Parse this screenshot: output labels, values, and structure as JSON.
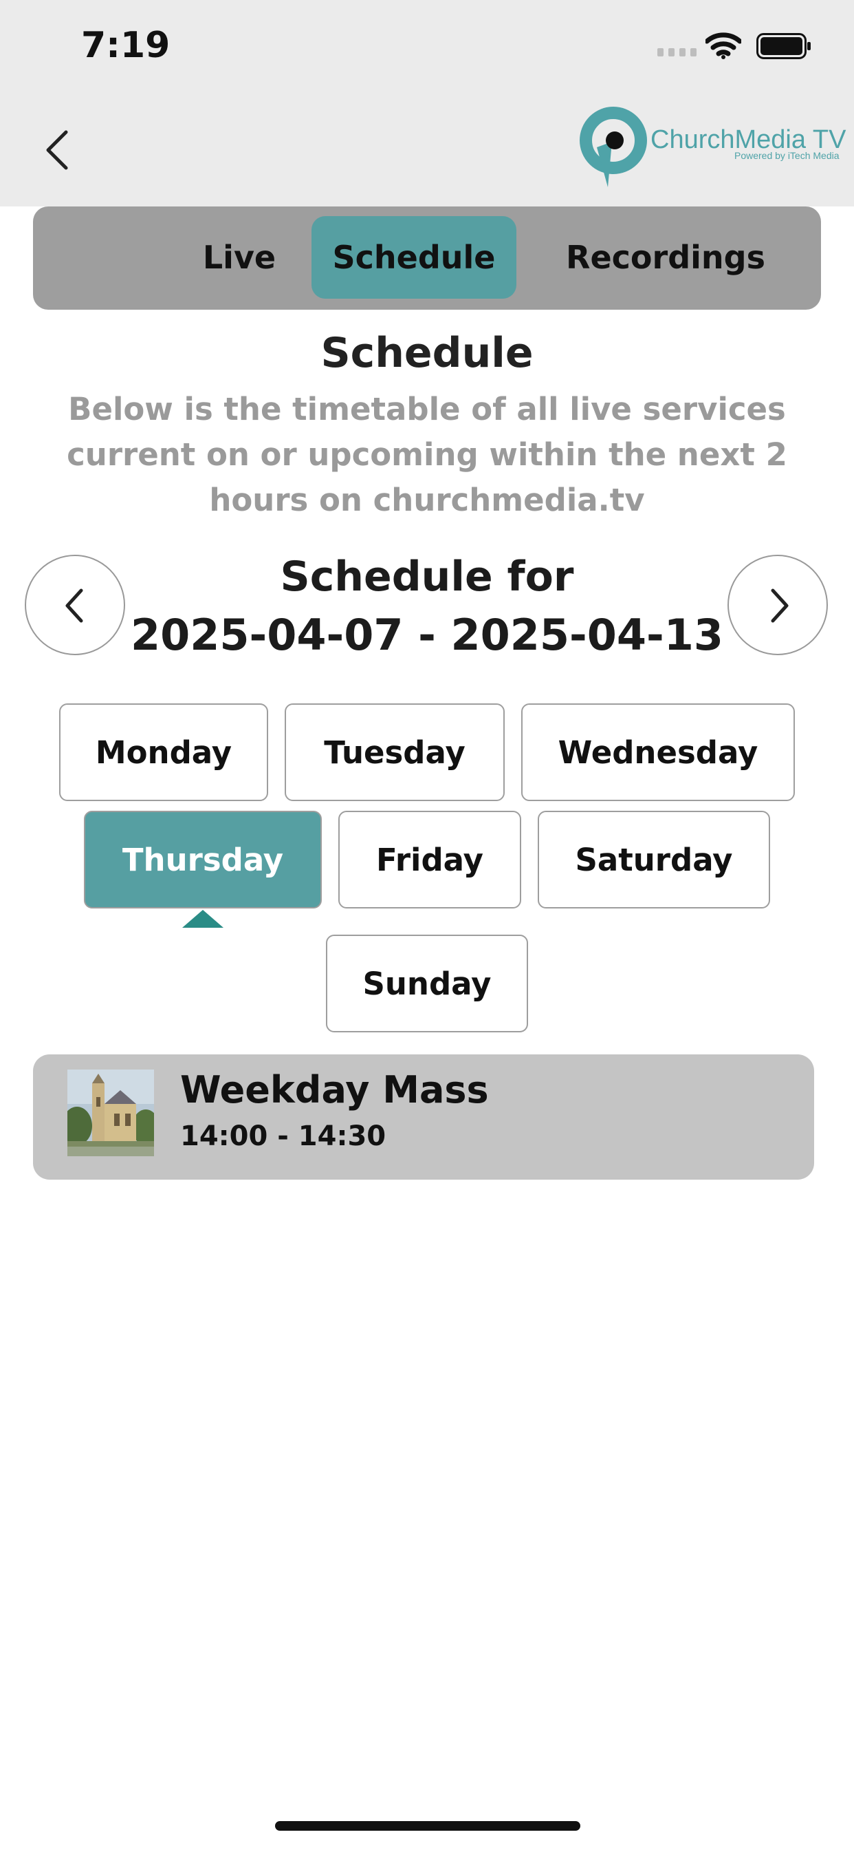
{
  "status_bar": {
    "time": "7:19"
  },
  "nav": {
    "logo_text": "ChurchMedia TV",
    "logo_subtext": "Powered by iTech Media"
  },
  "tabs": [
    {
      "label": "Live"
    },
    {
      "label": "Schedule",
      "selected": true
    },
    {
      "label": "Recordings"
    }
  ],
  "schedule": {
    "title": "Schedule",
    "description": "Below is the timetable of all live services current on or upcoming within the next 2 hours on churchmedia.tv",
    "for_label": "Schedule for",
    "date_range": "2025-04-07 - 2025-04-13"
  },
  "days": [
    {
      "label": "Monday"
    },
    {
      "label": "Tuesday"
    },
    {
      "label": "Wednesday"
    },
    {
      "label": "Thursday",
      "selected": true
    },
    {
      "label": "Friday"
    },
    {
      "label": "Saturday"
    },
    {
      "label": "Sunday"
    }
  ],
  "events": [
    {
      "title": "Weekday Mass",
      "time": "14:00 - 14:30"
    }
  ],
  "colors": {
    "accent": "#569fa2",
    "tab_bar": "#9e9e9e",
    "card": "#c4c4c4",
    "header": "#ebebeb"
  },
  "icons": [
    "chevron-left-icon",
    "chevron-right-icon",
    "wifi-icon",
    "battery-icon",
    "cellular-signal-icon"
  ]
}
